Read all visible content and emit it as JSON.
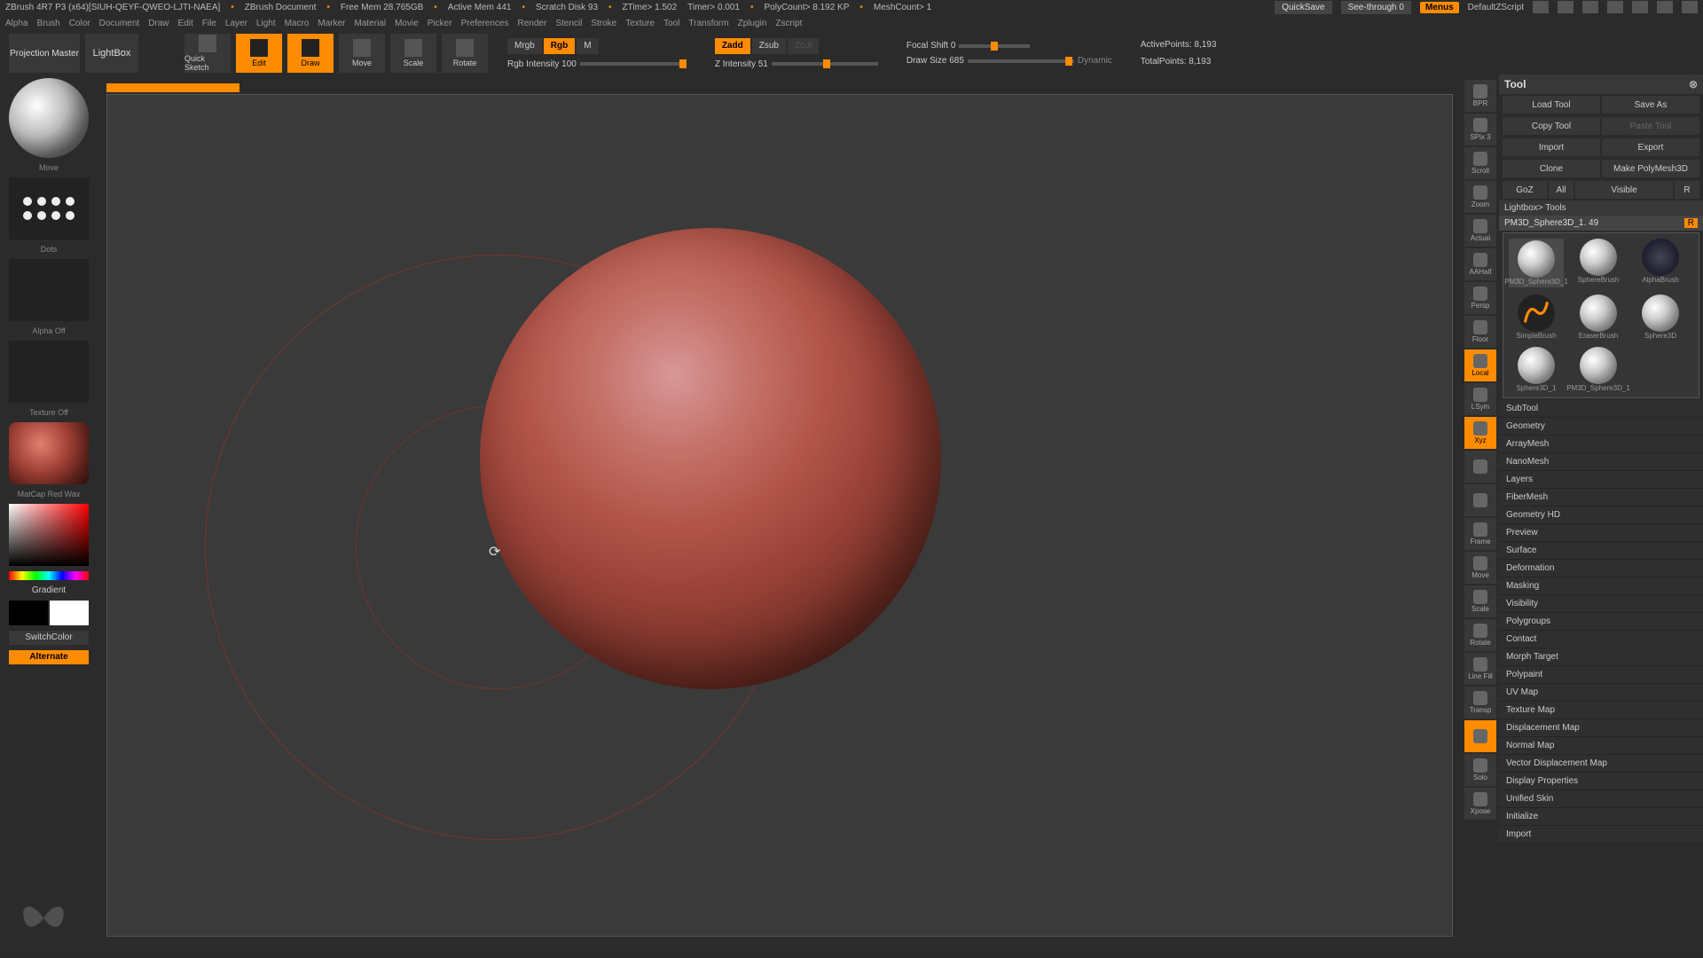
{
  "title": {
    "app": "ZBrush 4R7 P3 (x64)[SIUH-QEYF-QWEO-LJTI-NAEA]",
    "doc": "ZBrush Document",
    "mem": "Free Mem 28.765GB",
    "active_mem": "Active Mem 441",
    "scratch": "Scratch Disk 93",
    "ztime": "ZTime> 1.502",
    "timer": "Timer> 0.001",
    "poly": "PolyCount> 8.192 KP",
    "mesh": "MeshCount> 1",
    "quicksave": "QuickSave",
    "seethrough": "See-through   0",
    "menus": "Menus",
    "script": "DefaultZScript"
  },
  "menu": [
    "Alpha",
    "Brush",
    "Color",
    "Document",
    "Draw",
    "Edit",
    "File",
    "Layer",
    "Light",
    "Macro",
    "Marker",
    "Material",
    "Movie",
    "Picker",
    "Preferences",
    "Render",
    "Stencil",
    "Stroke",
    "Texture",
    "Tool",
    "Transform",
    "Zplugin",
    "Zscript"
  ],
  "toolbar": {
    "projection": "Projection Master",
    "lightbox": "LightBox",
    "quicksketch": "Quick Sketch",
    "edit": "Edit",
    "draw": "Draw",
    "move": "Move",
    "scale": "Scale",
    "rotate": "Rotate",
    "mrgb": "Mrgb",
    "rgb": "Rgb",
    "m": "M",
    "rgb_int": "Rgb Intensity 100",
    "zadd": "Zadd",
    "zsub": "Zsub",
    "zcut": "Zcut",
    "z_int": "Z Intensity 51",
    "focal": "Focal Shift 0",
    "drawsize": "Draw Size 685",
    "dynamic": "Dynamic",
    "active_pts": "ActivePoints: 8,193",
    "total_pts": "TotalPoints: 8,193"
  },
  "left": {
    "brush": "Move",
    "stroke": "Dots",
    "alpha": "Alpha Off",
    "texture": "Texture Off",
    "material": "MatCap Red Wax",
    "gradient": "Gradient",
    "switch": "SwitchColor",
    "alternate": "Alternate"
  },
  "right_strip": [
    {
      "label": "BPR",
      "on": false
    },
    {
      "label": "SPix 3",
      "on": false
    },
    {
      "label": "Scroll",
      "on": false
    },
    {
      "label": "Zoom",
      "on": false
    },
    {
      "label": "Actual",
      "on": false
    },
    {
      "label": "AAHalf",
      "on": false
    },
    {
      "label": "Persp",
      "on": false
    },
    {
      "label": "Floor",
      "on": false
    },
    {
      "label": "Local",
      "on": true
    },
    {
      "label": "LSym",
      "on": false
    },
    {
      "label": "Xyz",
      "on": true
    },
    {
      "label": "",
      "on": false
    },
    {
      "label": "",
      "on": false
    },
    {
      "label": "Frame",
      "on": false
    },
    {
      "label": "Move",
      "on": false
    },
    {
      "label": "Scale",
      "on": false
    },
    {
      "label": "Rotate",
      "on": false
    },
    {
      "label": "Line Fill",
      "on": false
    },
    {
      "label": "Transp",
      "on": false
    },
    {
      "label": "",
      "on": true
    },
    {
      "label": "Solo",
      "on": false
    },
    {
      "label": "Xpose",
      "on": false
    }
  ],
  "tool": {
    "header": "Tool",
    "load": "Load Tool",
    "saveas": "Save As",
    "copy": "Copy Tool",
    "paste": "Paste Tool",
    "import": "Import",
    "export": "Export",
    "clone": "Clone",
    "makepoly": "Make PolyMesh3D",
    "goz": "GoZ",
    "all": "All",
    "visible": "Visible",
    "r": "R",
    "lightbox_tools": "Lightbox> Tools",
    "name": "PM3D_Sphere3D_1. 49",
    "thumbs": [
      {
        "label": "PM3D_Sphere3D_1",
        "kind": "ball",
        "sel": true
      },
      {
        "label": "SphereBrush",
        "kind": "ball"
      },
      {
        "label": "AlphaBrush",
        "kind": "alpha"
      },
      {
        "label": "SimpleBrush",
        "kind": "simple"
      },
      {
        "label": "EraserBrush",
        "kind": "ball"
      },
      {
        "label": "Sphere3D",
        "kind": "ball"
      },
      {
        "label": "Sphere3D_1",
        "kind": "ball"
      },
      {
        "label": "PM3D_Sphere3D_1",
        "kind": "ball"
      }
    ],
    "accordion": [
      "SubTool",
      "Geometry",
      "ArrayMesh",
      "NanoMesh",
      "Layers",
      "FiberMesh",
      "Geometry HD",
      "Preview",
      "Surface",
      "Deformation",
      "Masking",
      "Visibility",
      "Polygroups",
      "Contact",
      "Morph Target",
      "Polypaint",
      "UV Map",
      "Texture Map",
      "Displacement Map",
      "Normal Map",
      "Vector Displacement Map",
      "Display Properties",
      "Unified Skin",
      "Initialize",
      "Import"
    ]
  }
}
